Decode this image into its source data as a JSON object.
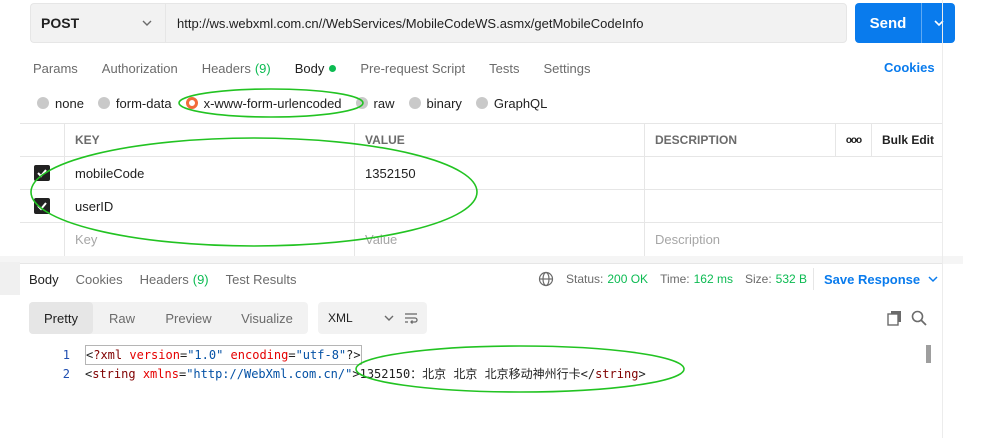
{
  "request": {
    "method": "POST",
    "url": "http://ws.webxml.com.cn//WebServices/MobileCodeWS.asmx/getMobileCodeInfo",
    "send_label": "Send"
  },
  "req_tabs": [
    {
      "label": "Params"
    },
    {
      "label": "Authorization"
    },
    {
      "label": "Headers",
      "count": "(9)"
    },
    {
      "label": "Body"
    },
    {
      "label": "Pre-request Script"
    },
    {
      "label": "Tests"
    },
    {
      "label": "Settings"
    }
  ],
  "cookies_label": "Cookies",
  "body_types": [
    {
      "label": "none"
    },
    {
      "label": "form-data"
    },
    {
      "label": "x-www-form-urlencoded"
    },
    {
      "label": "raw"
    },
    {
      "label": "binary"
    },
    {
      "label": "GraphQL"
    }
  ],
  "table": {
    "headers": {
      "key": "KEY",
      "value": "VALUE",
      "description": "DESCRIPTION",
      "bulk_edit": "Bulk Edit",
      "more": "ooo"
    },
    "rows": [
      {
        "key": "mobileCode",
        "value": "1352150",
        "description": ""
      },
      {
        "key": "userID",
        "value": "",
        "description": ""
      }
    ],
    "placeholders": {
      "key": "Key",
      "value": "Value",
      "description": "Description"
    }
  },
  "resp_tabs": [
    {
      "label": "Body"
    },
    {
      "label": "Cookies"
    },
    {
      "label": "Headers",
      "count": "(9)"
    },
    {
      "label": "Test Results"
    }
  ],
  "resp_meta": {
    "status_label": "Status:",
    "status_value": "200 OK",
    "time_label": "Time:",
    "time_value": "162 ms",
    "size_label": "Size:",
    "size_value": "532 B",
    "save_label": "Save Response"
  },
  "format": {
    "buttons": [
      {
        "label": "Pretty"
      },
      {
        "label": "Raw"
      },
      {
        "label": "Preview"
      },
      {
        "label": "Visualize"
      }
    ],
    "language": "XML"
  },
  "code": {
    "line_numbers": [
      "1",
      "2"
    ],
    "l1": {
      "open": "<",
      "decl": "?xml",
      "a1": "version",
      "eq": "=",
      "v1": "\"1.0\"",
      "a2": "encoding",
      "v2": "\"utf-8\"",
      "close": "?>"
    },
    "l2": {
      "open": "<",
      "tag": "string",
      "a1": "xmlns",
      "eq": "=",
      "v1": "\"http://WebXml.com.cn/\"",
      "gt": ">",
      "text": "1352150：北京 北京 北京移动神州行卡",
      "end_open": "</",
      "end_tag": "string",
      "end_close": ">"
    }
  },
  "colors": {
    "accent": "#097bed",
    "success": "#0cbb52",
    "radio_selected": "#f26b3a",
    "annotation": "#22c322"
  }
}
